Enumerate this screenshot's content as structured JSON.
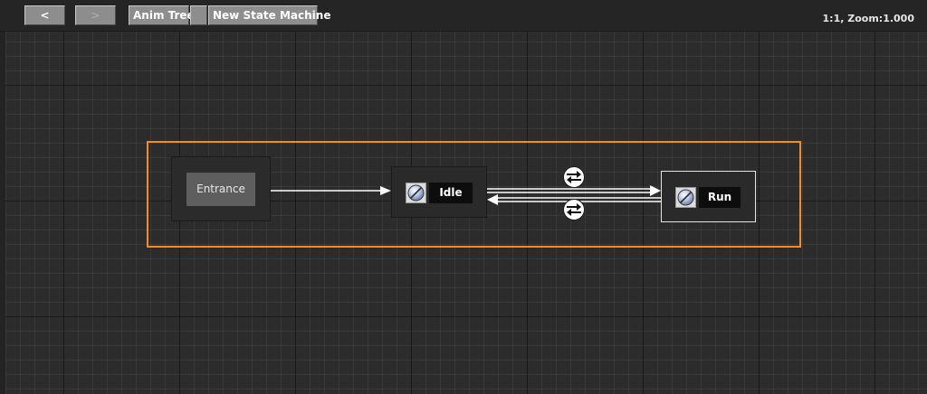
{
  "toolbar": {
    "back_label": "<",
    "forward_label": ">",
    "breadcrumbs": [
      {
        "label": "Anim Tree"
      },
      {
        "label": "New State Machine"
      }
    ],
    "zoom_readout": "1:1, Zoom:1.000"
  },
  "graph": {
    "entrance": {
      "label": "Entrance"
    },
    "states": [
      {
        "label": "Idle",
        "icon": "state-motion-icon"
      },
      {
        "label": "Run",
        "icon": "state-motion-icon",
        "selected": true
      }
    ],
    "transitions": [
      {
        "from": "Entrance",
        "to": "Idle"
      },
      {
        "from": "Idle",
        "to": "Run"
      },
      {
        "from": "Run",
        "to": "Idle"
      }
    ]
  },
  "colors": {
    "selection": "#f08c2c",
    "transition": "#ffffff",
    "canvas": "#2c2c2c"
  }
}
